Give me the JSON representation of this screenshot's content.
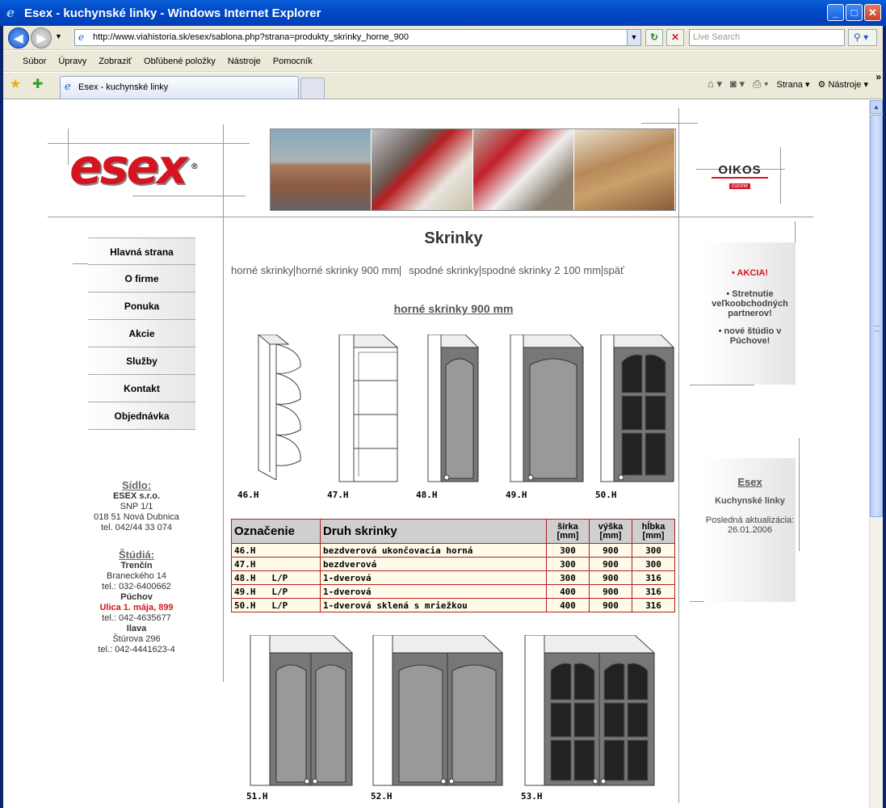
{
  "browser": {
    "title": "Esex - kuchynské linky - Windows Internet Explorer",
    "url": "http://www.viahistoria.sk/esex/sablona.php?strana=produkty_skrinky_horne_900",
    "search_placeholder": "Live Search",
    "menu": [
      "Súbor",
      "Úpravy",
      "Zobraziť",
      "Obľúbené položky",
      "Nástroje",
      "Pomocník"
    ],
    "tab_label": "Esex - kuchynské linky",
    "tools": {
      "page": "Strana",
      "tools": "Nástroje"
    }
  },
  "colors": {
    "brand_red": "#d51420",
    "table_border": "#b21f24"
  },
  "logos": {
    "brand": "esex",
    "partner": "OIKOS",
    "partner_sub": "cucine"
  },
  "nav": [
    "Hlavná strana",
    "O firme",
    "Ponuka",
    "Akcie",
    "Služby",
    "Kontakt",
    "Objednávka"
  ],
  "contact": {
    "hq_title": "Sídlo:",
    "company": "ESEX s.r.o.",
    "street": "SNP 1/1",
    "city": "018 51 Nová Dubnica",
    "phone": "tel. 042/44 33 074",
    "studios_title": "Štúdiá:",
    "s1_city": "Trenčín",
    "s1_street": "Braneckého 14",
    "s1_phone": "tel.: 032-6400662",
    "s2_city": "Púchov",
    "s2_street": "Ulica 1. mája, 899",
    "s2_phone": "tel.: 042-4635677",
    "s3_city": "Ilava",
    "s3_street": "Štúrova 296",
    "s3_phone": "tel.: 042-4441623-4"
  },
  "main": {
    "title": "Skrinky",
    "links": [
      "horné skrinky",
      "horné skrinky 900 mm",
      "spodné skrinky",
      "spodné skrinky 2 100 mm",
      "späť"
    ],
    "section": "horné skrinky 900 mm",
    "row1_labels": [
      "46.H",
      "47.H",
      "48.H",
      "49.H",
      "50.H"
    ],
    "row2_labels": [
      "51.H",
      "52.H",
      "53.H"
    ]
  },
  "table": {
    "headers": {
      "code": "Označenie",
      "type": "Druh skrinky",
      "width": "šírka [mm]",
      "height": "výška [mm]",
      "depth": "hĺbka [mm]"
    },
    "rows": [
      {
        "code": "46.H",
        "lp": "",
        "type": "bezdverová ukončovacia horná",
        "w": "300",
        "h": "900",
        "d": "300"
      },
      {
        "code": "47.H",
        "lp": "",
        "type": "bezdverová",
        "w": "300",
        "h": "900",
        "d": "300"
      },
      {
        "code": "48.H",
        "lp": "L/P",
        "type": "1-dverová",
        "w": "300",
        "h": "900",
        "d": "316"
      },
      {
        "code": "49.H",
        "lp": "L/P",
        "type": "1-dverová",
        "w": "400",
        "h": "900",
        "d": "316"
      },
      {
        "code": "50.H",
        "lp": "L/P",
        "type": "1-dverová sklená s mriežkou",
        "w": "400",
        "h": "900",
        "d": "316"
      }
    ]
  },
  "right": {
    "akcia": "• AKCIA!",
    "news1": "• Stretnutie veľkoobchodných partnerov!",
    "news2": "• nové štúdio v Púchove!",
    "brand": "Esex",
    "subtitle": "Kuchynské linky",
    "updated_label": "Posledná aktualizácia:",
    "updated": "26.01.2006"
  }
}
